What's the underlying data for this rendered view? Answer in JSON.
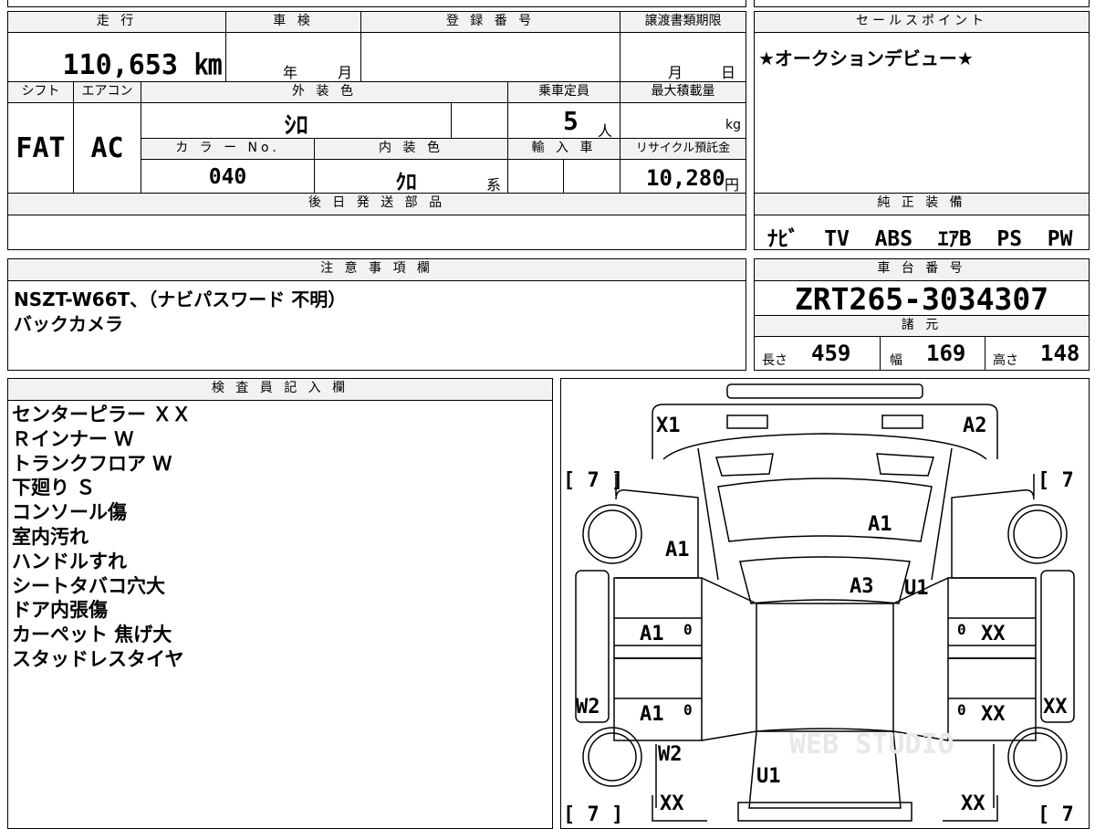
{
  "mileage": {
    "label": "走 行",
    "value": "110,653 ㎞"
  },
  "shaken": {
    "label": "車 検",
    "year_unit": "年",
    "month_unit": "月"
  },
  "registration": {
    "label": "登 録 番 号"
  },
  "transfer": {
    "label": "譲渡書類期限",
    "month_unit": "月",
    "day_unit": "日"
  },
  "sales_point": {
    "label": "セールスポイント",
    "text": "★オークションデビュー★"
  },
  "shift": {
    "label": "シフト",
    "value": "FAT"
  },
  "aircon": {
    "label": "エアコン",
    "value": "AC"
  },
  "exterior": {
    "label": "外 装 色",
    "value": "ｼﾛ"
  },
  "capacity": {
    "label": "乗車定員",
    "value": "5",
    "unit": "人"
  },
  "max_load": {
    "label": "最大積載量",
    "unit": "kg"
  },
  "color_no": {
    "label": "カ ラ ー No.",
    "value": "040"
  },
  "interior": {
    "label": "内 装 色",
    "value": "ｸﾛ",
    "suffix": "系"
  },
  "import_car": {
    "label": "輸 入 車"
  },
  "recycle": {
    "label": "リサイクル預託金",
    "value": "10,280",
    "unit": "円"
  },
  "later_parts": {
    "label": "後 日 発 送 部 品"
  },
  "equipment": {
    "label": "純 正 装 備",
    "value": "ﾅﾋﾞ  TV  ABS  ｴｱB  PS  PW"
  },
  "caution": {
    "label": "注 意 事 項 欄",
    "lines": [
      "NSZT-W66T、（ナビパスワード 不明）",
      "バックカメラ"
    ]
  },
  "chassis": {
    "label": "車 台 番 号",
    "value": "ZRT265-3034307"
  },
  "specs": {
    "label": "諸 元",
    "length_label": "長さ",
    "length": "459",
    "width_label": "幅",
    "width": "169",
    "height_label": "高さ",
    "height": "148"
  },
  "inspector": {
    "label": "検 査 員 記 入 欄",
    "lines": [
      "センターピラー ＸＸ",
      "Ｒインナー Ｗ",
      "トランクフロア Ｗ",
      "下廻り Ｓ",
      "コンソール傷",
      "室内汚れ",
      "ハンドルすれ",
      "シートタバコ穴大",
      "ドア内張傷",
      "カーペット 焦げ大",
      "スタッドレスタイヤ"
    ]
  },
  "diagram": {
    "marks": [
      "X1",
      "A2",
      "[ 7 ]",
      "[ 7 ]",
      "A1",
      "A1",
      "A3",
      "U1",
      "A1",
      "XX",
      "W2",
      "A1",
      "XX",
      "XX",
      "W2",
      "U1",
      "XX",
      "XX",
      "[ 7 ]",
      "[ 7 ]"
    ],
    "watermark": "WEB STUDIO"
  }
}
